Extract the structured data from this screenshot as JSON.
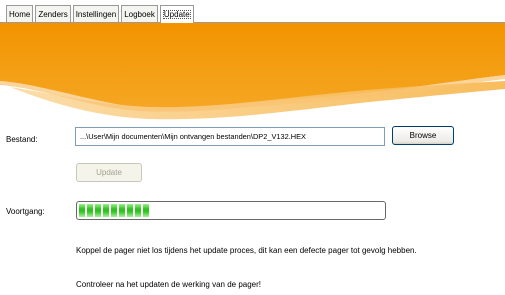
{
  "tabs": [
    {
      "label": "Home"
    },
    {
      "label": "Zenders"
    },
    {
      "label": "Instellingen"
    },
    {
      "label": "Logboek"
    },
    {
      "label": "Update"
    }
  ],
  "active_tab": "Update",
  "colors": {
    "banner_orange": "#f29400",
    "banner_light": "#f8c66a",
    "progress_green": "#36c524"
  },
  "file": {
    "label": "Bestand:",
    "value": "...\\User\\Mijn documenten\\Mijn ontvangen bestanden\\DP2_V132.HEX",
    "browse_label": "Browse"
  },
  "update_button": {
    "label": "Update",
    "enabled": false
  },
  "progress": {
    "label": "Voortgang:",
    "fraction": 0.23
  },
  "messages": {
    "warning": "Koppel de pager niet los tijdens het update proces, dit kan een defecte pager tot gevolg hebben.",
    "check": "Controleer na het updaten de werking van de pager!"
  }
}
